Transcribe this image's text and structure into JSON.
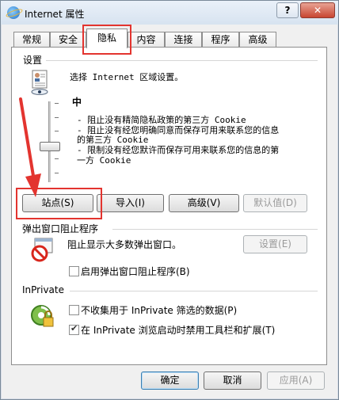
{
  "window": {
    "title": "Internet 属性",
    "help_label": "?",
    "close_label": "✕"
  },
  "tabs": [
    {
      "label": "常规"
    },
    {
      "label": "安全"
    },
    {
      "label": "隐私",
      "active": true
    },
    {
      "label": "内容"
    },
    {
      "label": "连接"
    },
    {
      "label": "程序"
    },
    {
      "label": "高级"
    }
  ],
  "settings": {
    "group_label": "设置",
    "zone_text": "选择 Internet 区域设置。",
    "level": "中",
    "bullets": [
      "- 阻止没有精简隐私政策的第三方 Cookie",
      "- 阻止没有经您明确同意而保存可用来联系您的信息",
      "的第三方 Cookie",
      "- 限制没有经您默许而保存可用来联系您的信息的第",
      "一方 Cookie"
    ],
    "buttons": {
      "sites": "站点(S)",
      "import": "导入(I)",
      "advanced": "高级(V)",
      "default": "默认值(D)"
    }
  },
  "popup": {
    "group_label": "弹出窗口阻止程序",
    "text": "阻止显示大多数弹出窗口。",
    "settings_button": "设置(E)",
    "checkbox_label": "启用弹出窗口阻止程序(B)",
    "checkbox_checked": false
  },
  "inprivate": {
    "group_label": "InPrivate",
    "checkbox1_label": "不收集用于 InPrivate 筛选的数据(P)",
    "checkbox1_checked": false,
    "checkbox2_label": "在 InPrivate 浏览启动时禁用工具栏和扩展(T)",
    "checkbox2_checked": true
  },
  "footer": {
    "ok": "确定",
    "cancel": "取消",
    "apply": "应用(A)"
  },
  "colors": {
    "highlight": "#e3342f",
    "close": "#c84531"
  }
}
